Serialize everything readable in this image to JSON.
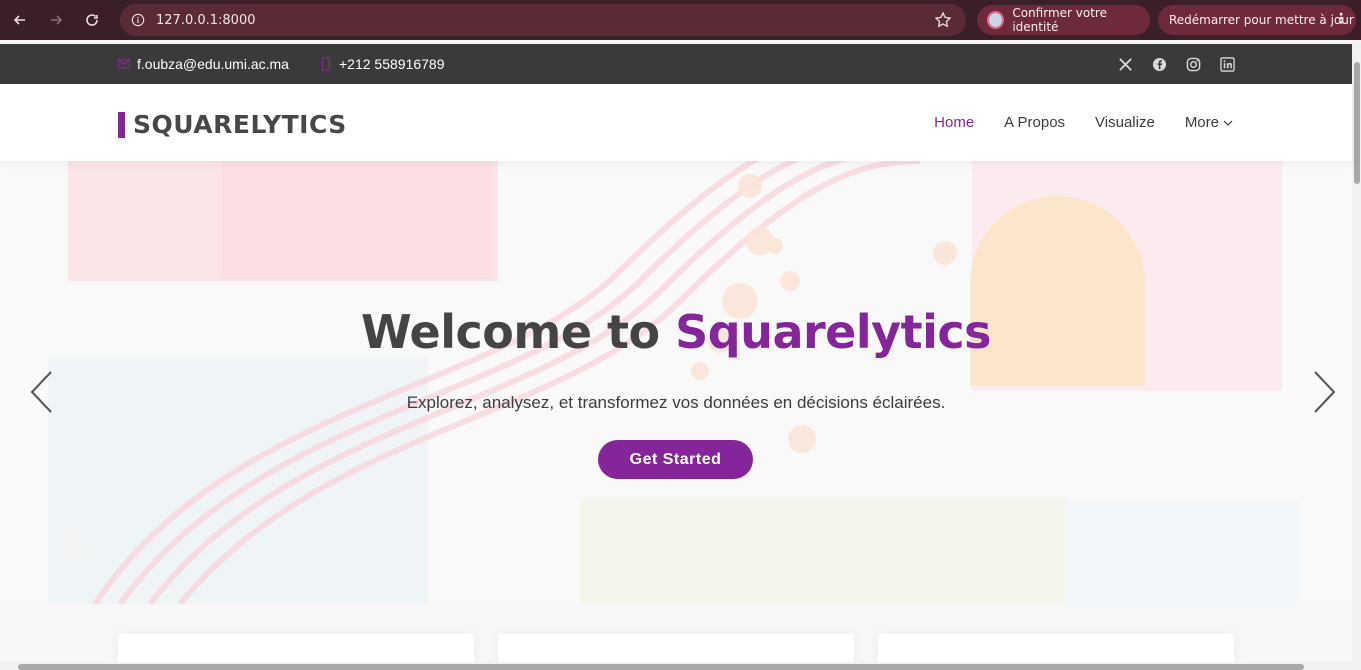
{
  "browser": {
    "url": "127.0.0.1:8000",
    "identity_label": "Confirmer votre identité",
    "restart_label": "Redémarrer pour mettre à jour"
  },
  "topbar": {
    "email": "f.oubza@edu.umi.ac.ma",
    "phone": "+212 558916789",
    "socials": [
      "x-icon",
      "facebook-icon",
      "instagram-icon",
      "linkedin-icon"
    ]
  },
  "header": {
    "logo": "SQUARELYTICS",
    "nav": {
      "home": "Home",
      "apropos": "A Propos",
      "visualize": "Visualize",
      "more": "More"
    }
  },
  "hero": {
    "title_prefix": "Welcome to ",
    "title_accent": "Squarelytics",
    "subtitle": "Explorez, analysez, et transformez vos données en décisions éclairées.",
    "cta": "Get Started"
  },
  "colors": {
    "accent": "#84269a",
    "topbar": "#3a3a3a",
    "chrome": "#3b1f28"
  }
}
